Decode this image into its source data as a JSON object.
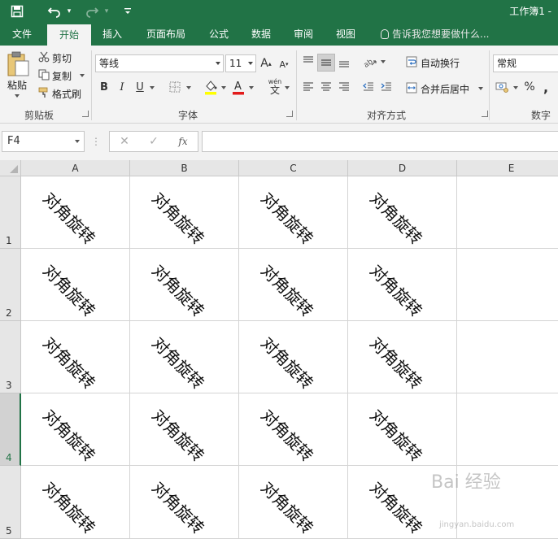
{
  "app": {
    "title": "工作簿1 -"
  },
  "menu": {
    "tabs": [
      "文件",
      "开始",
      "插入",
      "页面布局",
      "公式",
      "数据",
      "审阅",
      "视图"
    ],
    "active": "开始",
    "tell_me": "告诉我您想要做什么..."
  },
  "ribbon": {
    "clipboard": {
      "label": "剪贴板",
      "paste": "粘贴",
      "cut": "剪切",
      "copy": "复制",
      "format_painter": "格式刷"
    },
    "font": {
      "label": "字体",
      "name": "等线",
      "size": "11",
      "bold": "B",
      "italic": "I",
      "underline": "U",
      "wen": "wén",
      "wen2": "文"
    },
    "alignment": {
      "label": "对齐方式",
      "wrap_text": "自动换行",
      "merge_center": "合并后居中"
    },
    "number": {
      "label": "数字",
      "format": "常规",
      "percent": "%"
    }
  },
  "formula_bar": {
    "name_box": "F4",
    "fx": "fx"
  },
  "grid": {
    "columns": [
      "A",
      "B",
      "C",
      "D",
      "E"
    ],
    "rows": [
      "1",
      "2",
      "3",
      "4",
      "5"
    ],
    "active_row": "4",
    "cells": [
      [
        "对角旋转",
        "对角旋转",
        "对角旋转",
        "对角旋转",
        ""
      ],
      [
        "对角旋转",
        "对角旋转",
        "对角旋转",
        "对角旋转",
        ""
      ],
      [
        "对角旋转",
        "对角旋转",
        "对角旋转",
        "对角旋转",
        ""
      ],
      [
        "对角旋转",
        "对角旋转",
        "对角旋转",
        "对角旋转",
        ""
      ],
      [
        "对角旋转",
        "对角旋转",
        "对角旋转",
        "对角旋转",
        ""
      ]
    ]
  },
  "watermark": {
    "text": "Bai 经验",
    "sub": "jingyan.baidu.com"
  },
  "colors": {
    "accent": "#217346",
    "ribbon_bg": "#f3f3f3",
    "grid_line": "#d4d4d4"
  }
}
